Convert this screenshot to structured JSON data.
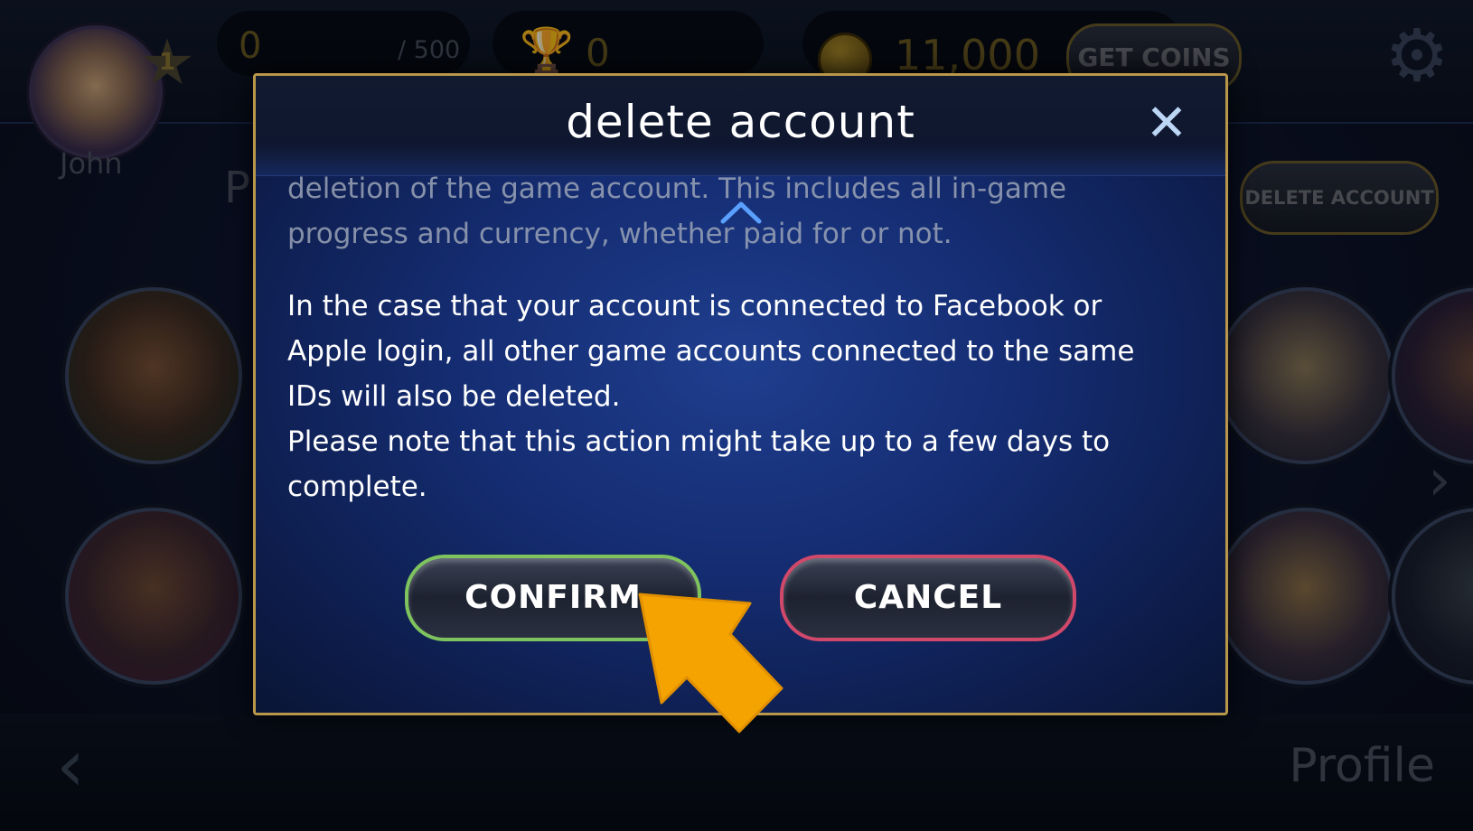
{
  "background": {
    "player_name": "John",
    "level": "1",
    "xp_current": "0",
    "xp_max": "/ 500",
    "trophies": "0",
    "coins": "11,000",
    "get_coins_label": "GET COINS",
    "delete_account_label": "DELETE ACCOUNT",
    "section_letter": "P",
    "page_title": "Profile"
  },
  "modal": {
    "title": "delete account",
    "faded_text": "deletion of the game account. This includes all in-game progress and currency, whether paid for or not.",
    "paragraph_1": "In the case that your account is connected to Facebook or Apple login, all other game accounts connected to the same IDs will also be deleted.",
    "paragraph_2": "Please note that this action might take up to a few days to complete.",
    "confirm_label": "CONFIRM",
    "cancel_label": "CANCEL"
  },
  "colors": {
    "accent_gold": "#b8964a",
    "confirm_border": "#7ec35e",
    "cancel_border": "#d0486a",
    "pointer": "#f5a300"
  }
}
